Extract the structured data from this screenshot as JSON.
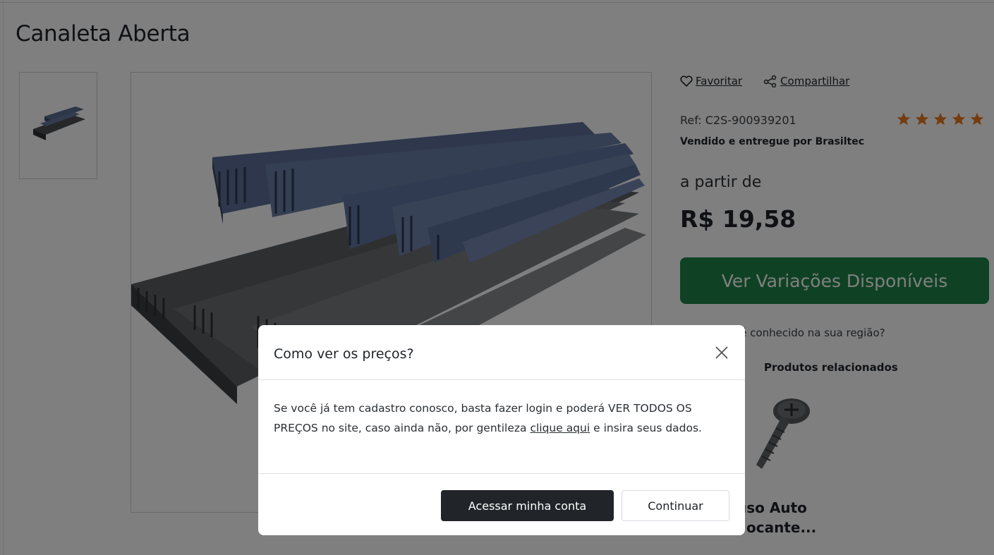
{
  "product": {
    "title": "Canaleta Aberta",
    "favorite_label": "Favoritar",
    "share_label": "Compartilhar",
    "ref": "Ref: C2S-900939201",
    "rating_stars": 5,
    "seller": "Vendido e entregue por Brasiltec",
    "from_label": "a partir de",
    "price": "R$ 19,58",
    "variations_button": "Ver Variações Disponíveis",
    "region_question": "Esse produto é conhecido na sua região?",
    "region_question_visible": "se produto é conhecido na sua região?"
  },
  "related": {
    "title": "Produtos relacionados",
    "item_name_line1": "uso Auto",
    "item_name_line2": "ocante..."
  },
  "modal": {
    "title": "Como ver os preços?",
    "body_part1": "Se você já tem cadastro conosco, basta fazer login e poderá VER TODOS OS PREÇOS no site, caso ainda não, por gentileza ",
    "body_link": "clique aqui",
    "body_part2": " e insira seus dados.",
    "primary_button": "Acessar minha conta",
    "secondary_button": "Continuar"
  },
  "colors": {
    "primary_green": "#1f8448",
    "star_orange": "#e9781e",
    "dark_button": "#212529"
  }
}
